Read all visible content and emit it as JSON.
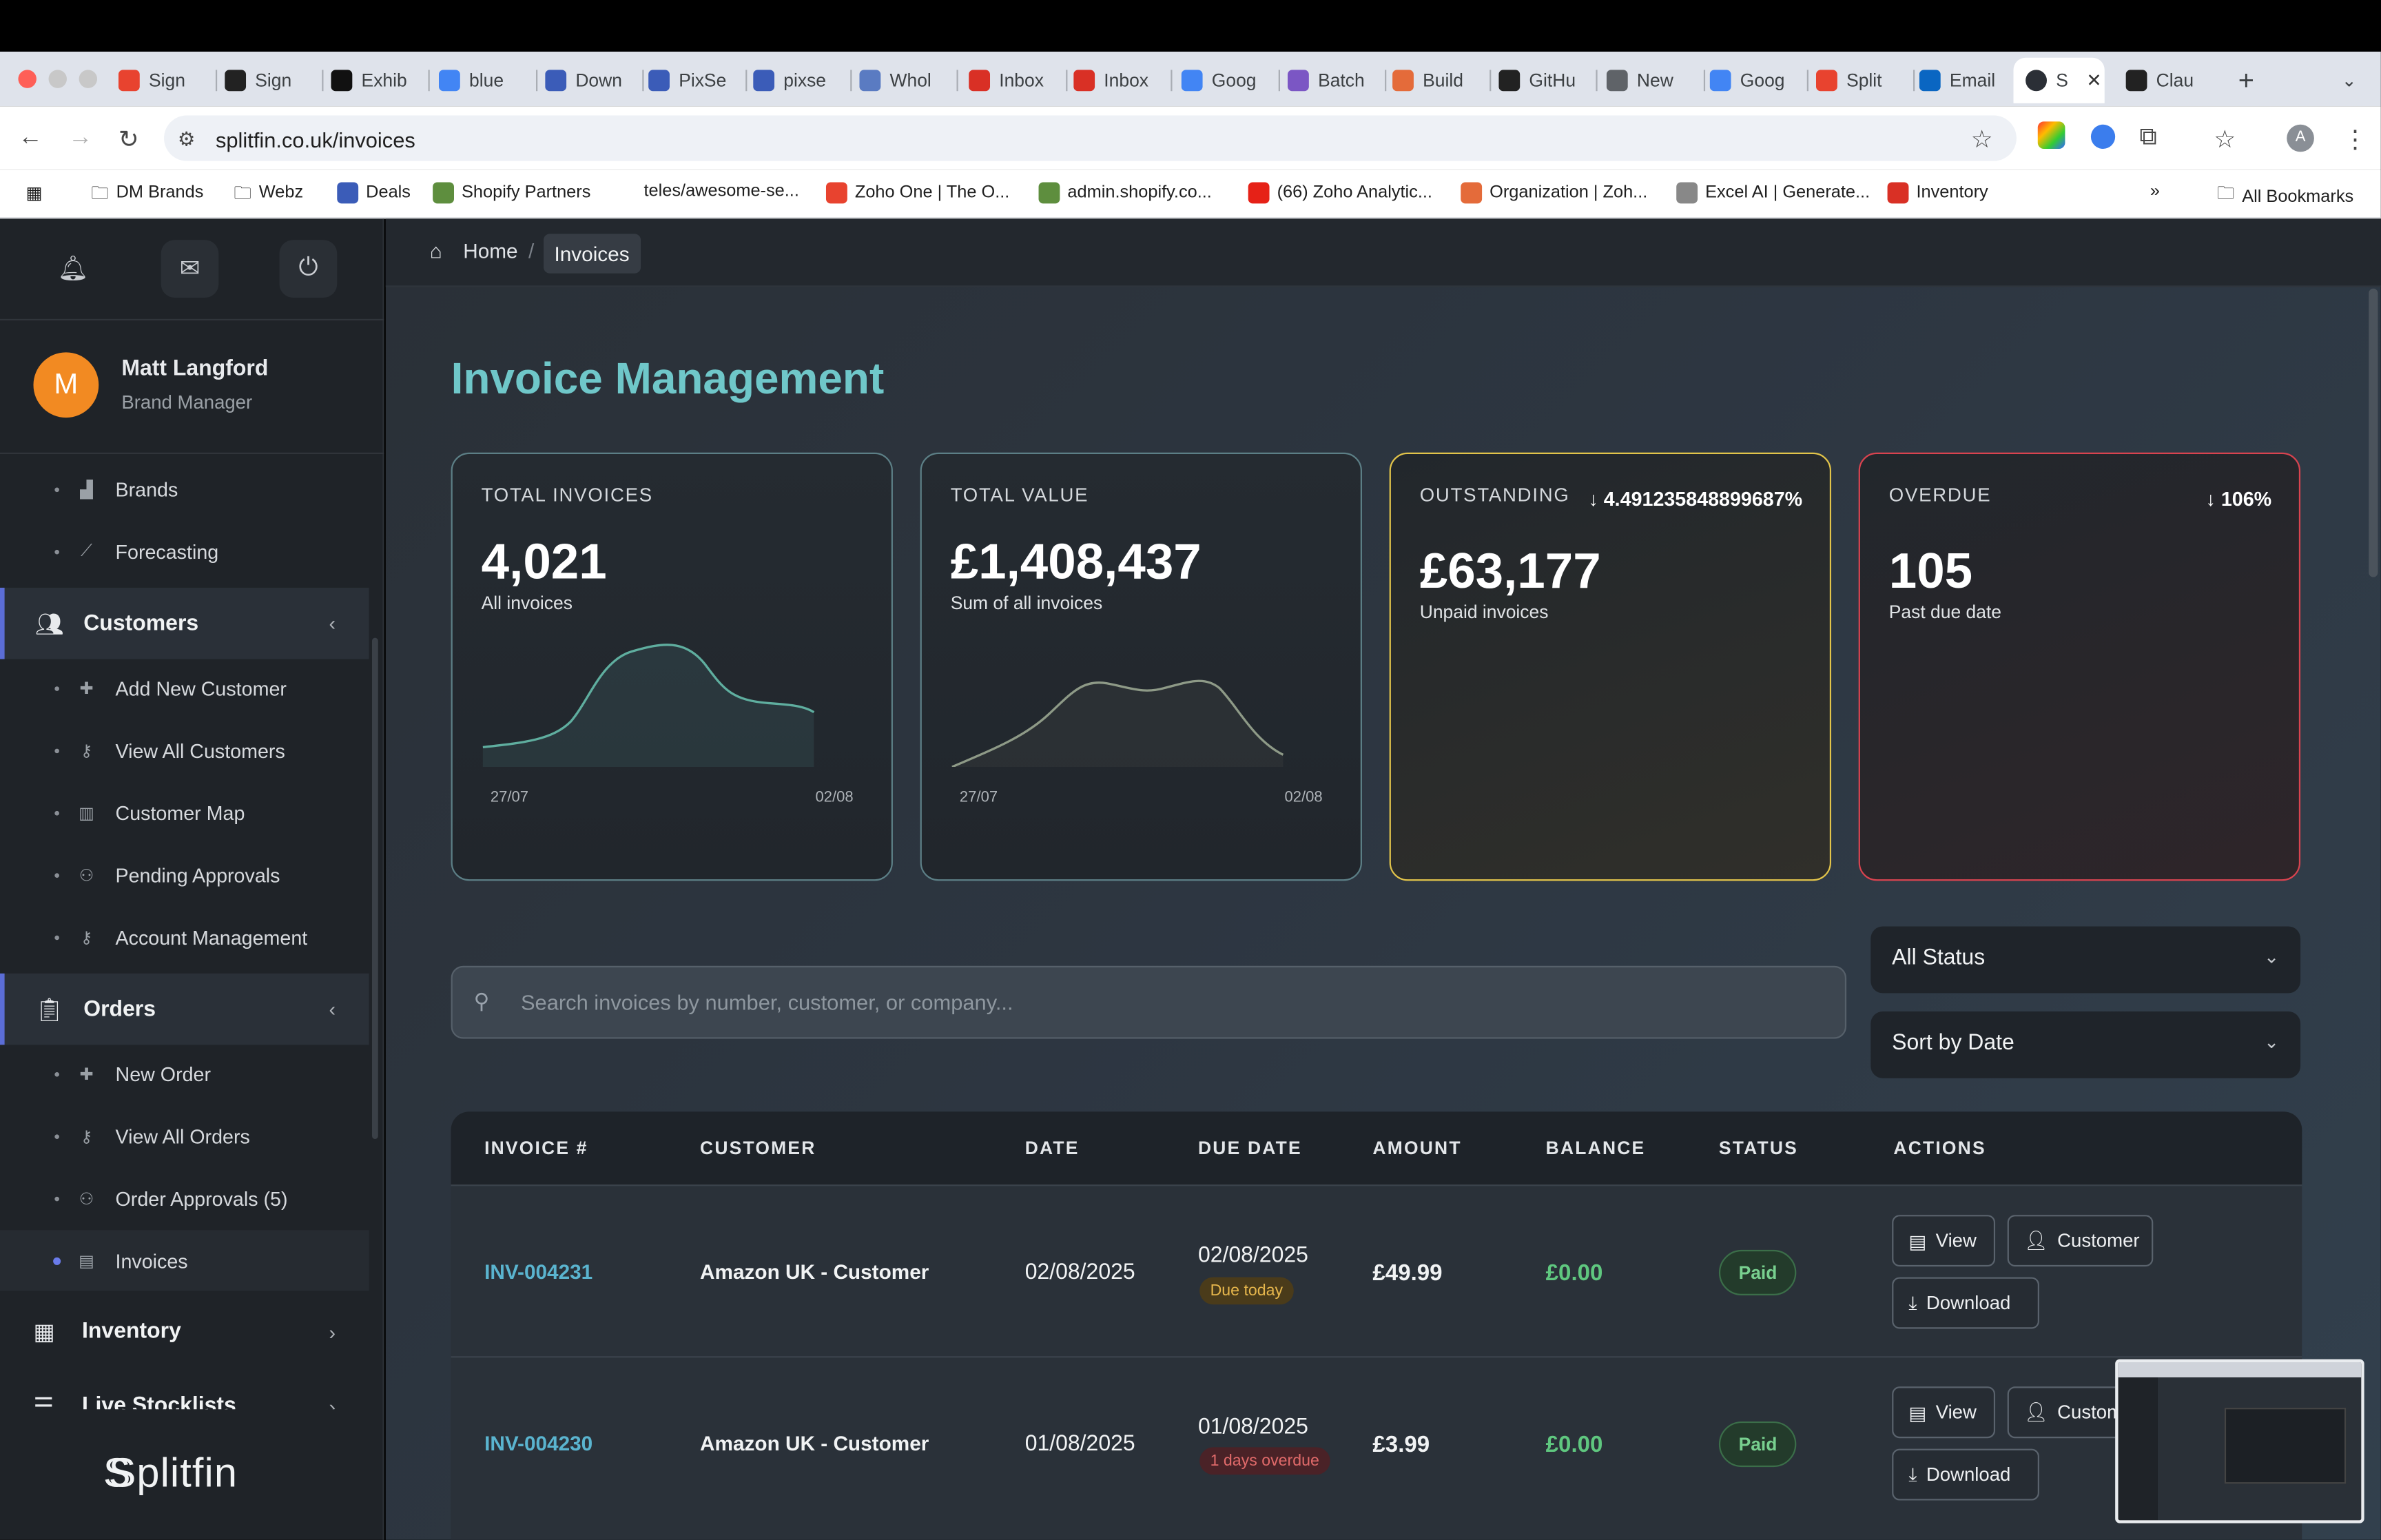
{
  "browser": {
    "tabs": [
      "Sign",
      "Sign",
      "Exhib",
      "blue",
      "Down",
      "PixSe",
      "pixse",
      "Whol",
      "Inbox",
      "Inbox",
      "Goog",
      "Batch",
      "Build",
      "GitHu",
      "New",
      "Goog",
      "Split",
      "Email",
      "S",
      "Clau"
    ],
    "url": "splitfin.co.uk/invoices",
    "bookmarks": [
      "DM Brands",
      "Webz",
      "Deals",
      "Shopify Partners",
      "teles/awesome-se...",
      "Zoho One | The O...",
      "admin.shopify.co...",
      "(66) Zoho Analytic...",
      "Organization | Zoh...",
      "Excel AI | Generate...",
      "Inventory"
    ],
    "all_bookmarks": "All Bookmarks"
  },
  "sidebar": {
    "user": {
      "initial": "M",
      "name": "Matt Langford",
      "role": "Brand Manager"
    },
    "top_items": [
      {
        "label": "Brands",
        "icon": "brands-icon"
      },
      {
        "label": "Forecasting",
        "icon": "chart-icon"
      }
    ],
    "customers": {
      "label": "Customers",
      "items": [
        {
          "label": "Add New Customer"
        },
        {
          "label": "View All Customers"
        },
        {
          "label": "Customer Map"
        },
        {
          "label": "Pending Approvals"
        },
        {
          "label": "Account Management"
        }
      ]
    },
    "orders": {
      "label": "Orders",
      "items": [
        {
          "label": "New Order"
        },
        {
          "label": "View All Orders"
        },
        {
          "label": "Order Approvals (5)"
        },
        {
          "label": "Invoices"
        }
      ]
    },
    "inventory": "Inventory",
    "live_stocklists": "Live Stocklists",
    "logo": "Splitfin"
  },
  "breadcrumb": {
    "home": "Home",
    "current": "Invoices"
  },
  "page_title": "Invoice Management",
  "cards": [
    {
      "title": "TOTAL INVOICES",
      "value": "4,021",
      "sub": "All invoices",
      "date_start": "27/07",
      "date_end": "02/08"
    },
    {
      "title": "TOTAL VALUE",
      "value": "£1,408,437",
      "sub": "Sum of all invoices",
      "date_start": "27/07",
      "date_end": "02/08"
    },
    {
      "title": "OUTSTANDING",
      "value": "£63,177",
      "sub": "Unpaid invoices",
      "trend": "↓ 4.491235848899687%",
      "border": "#e2c44a"
    },
    {
      "title": "OVERDUE",
      "value": "105",
      "sub": "Past due date",
      "trend": "↓ 106%",
      "border": "#d9434f"
    }
  ],
  "search": {
    "placeholder": "Search invoices by number, customer, or company..."
  },
  "filters": {
    "status": "All Status",
    "sort": "Sort by Date"
  },
  "table": {
    "headers": [
      "INVOICE #",
      "CUSTOMER",
      "DATE",
      "DUE DATE",
      "AMOUNT",
      "BALANCE",
      "STATUS",
      "ACTIONS"
    ],
    "rows": [
      {
        "invoice": "INV-004231",
        "customer": "Amazon UK - Customer",
        "date": "02/08/2025",
        "due": "02/08/2025",
        "due_note": "Due today",
        "amount": "£49.99",
        "balance": "£0.00",
        "status": "Paid"
      },
      {
        "invoice": "INV-004230",
        "customer": "Amazon UK - Customer",
        "date": "01/08/2025",
        "due": "01/08/2025",
        "due_note": "1 days overdue",
        "amount": "£3.99",
        "balance": "£0.00",
        "status": "Paid"
      }
    ],
    "actions": {
      "view": "View",
      "customer": "Customer",
      "customer_clipped": "Custom",
      "download": "Download"
    }
  },
  "colors": {
    "accent": "#6fc7c9",
    "paid": "#78d08f",
    "outstanding": "#e2c44a",
    "overdue": "#d9434f"
  }
}
